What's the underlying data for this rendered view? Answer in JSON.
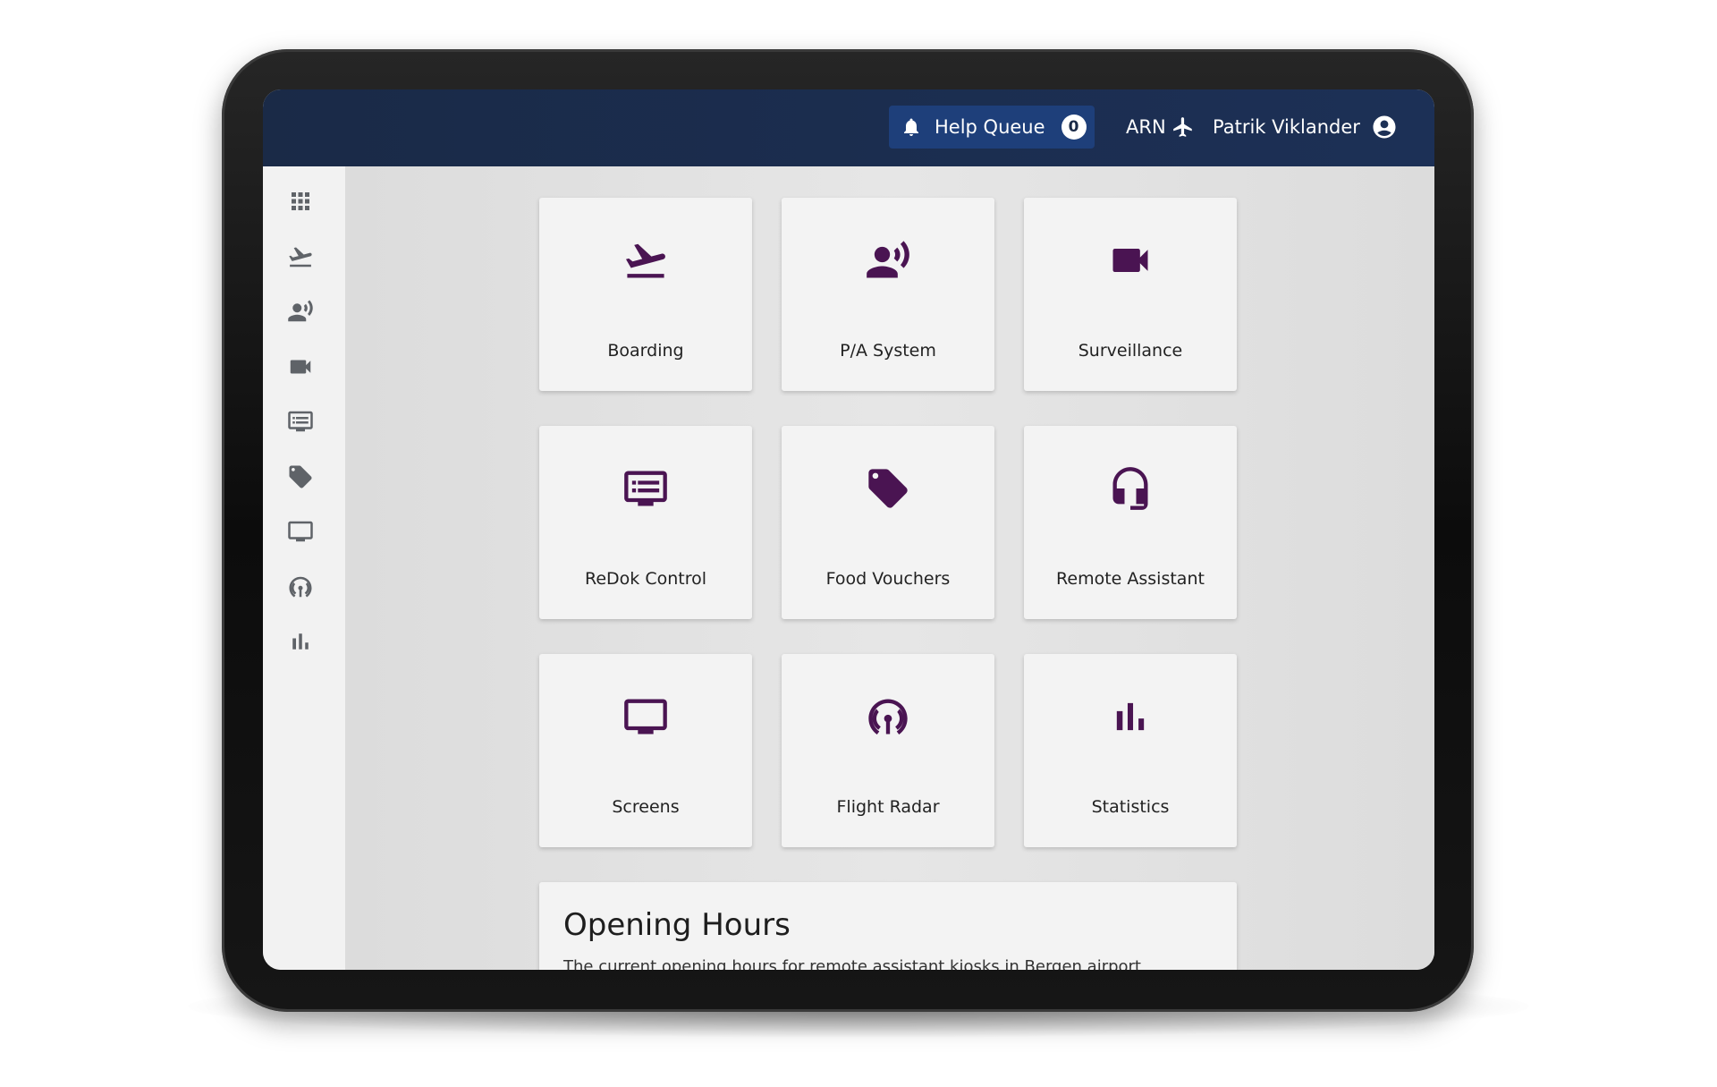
{
  "header": {
    "help_queue_label": "Help Queue",
    "help_queue_count": "0",
    "airport_code": "ARN",
    "user_name": "Patrik Viklander"
  },
  "sidebar": {
    "items": [
      {
        "icon": "apps-grid-icon"
      },
      {
        "icon": "departure-icon"
      },
      {
        "icon": "pa-system-icon"
      },
      {
        "icon": "video-camera-icon"
      },
      {
        "icon": "display-list-icon"
      },
      {
        "icon": "tag-icon"
      },
      {
        "icon": "monitor-icon"
      },
      {
        "icon": "radar-icon"
      },
      {
        "icon": "bar-chart-icon"
      }
    ]
  },
  "tiles": [
    {
      "label": "Boarding",
      "icon": "departure-icon"
    },
    {
      "label": "P/A System",
      "icon": "pa-system-icon"
    },
    {
      "label": "Surveillance",
      "icon": "video-camera-icon"
    },
    {
      "label": "ReDok Control",
      "icon": "display-list-icon"
    },
    {
      "label": "Food Vouchers",
      "icon": "tag-icon"
    },
    {
      "label": "Remote Assistant",
      "icon": "headset-icon"
    },
    {
      "label": "Screens",
      "icon": "monitor-icon"
    },
    {
      "label": "Flight Radar",
      "icon": "radar-icon"
    },
    {
      "label": "Statistics",
      "icon": "bar-chart-icon"
    }
  ],
  "opening_hours": {
    "title": "Opening Hours",
    "description": "The current opening hours for remote assistant kiosks in Bergen airport"
  },
  "colors": {
    "accent": "#4a1452",
    "sidebar_icon": "#5f6368",
    "topbar": "#1a2a47",
    "help_queue_bg": "#1e3f7a"
  }
}
